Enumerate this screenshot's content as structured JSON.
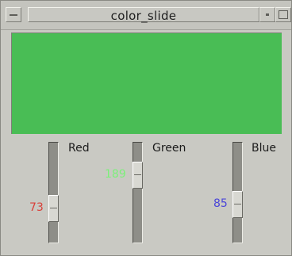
{
  "window": {
    "title": "color_slide"
  },
  "color": {
    "red": 73,
    "green": 189,
    "blue": 85,
    "swatch_hex": "#49bd55"
  },
  "sliders": [
    {
      "label": "Red",
      "value": "73",
      "value_color": "#d9403a",
      "min": 0,
      "max": 255
    },
    {
      "label": "Green",
      "value": "189",
      "value_color": "#7cf07a",
      "min": 0,
      "max": 255
    },
    {
      "label": "Blue",
      "value": "85",
      "value_color": "#4a45d8",
      "min": 0,
      "max": 255
    }
  ],
  "icons": {
    "window_menu": "dash-icon",
    "minimize": "minimize-icon",
    "maximize": "maximize-icon"
  }
}
